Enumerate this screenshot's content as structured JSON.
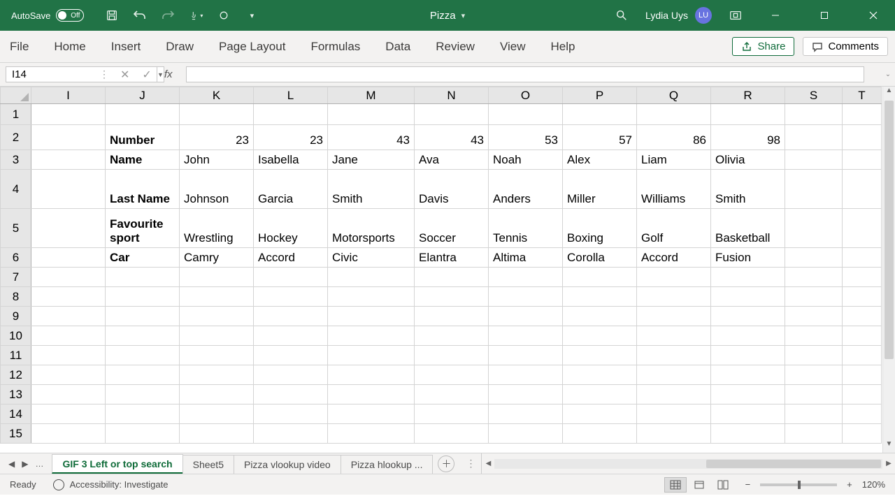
{
  "titlebar": {
    "autosave_label": "AutoSave",
    "autosave_state": "Off",
    "doc_name": "Pizza",
    "user_name": "Lydia Uys",
    "user_initials": "LU"
  },
  "ribbon": {
    "tabs": [
      "File",
      "Home",
      "Insert",
      "Draw",
      "Page Layout",
      "Formulas",
      "Data",
      "Review",
      "View",
      "Help"
    ],
    "share_label": "Share",
    "comments_label": "Comments"
  },
  "formula_bar": {
    "name_box": "I14",
    "formula": ""
  },
  "column_headers": [
    "I",
    "J",
    "K",
    "L",
    "M",
    "N",
    "O",
    "P",
    "Q",
    "R",
    "S",
    "T"
  ],
  "row_numbers": [
    1,
    2,
    3,
    4,
    5,
    6,
    7,
    8,
    9,
    10,
    11,
    12,
    13,
    14,
    15
  ],
  "row_labels": {
    "2": "Number",
    "3": "Name",
    "4": "Last Name",
    "5": "Favourite sport",
    "6": "Car"
  },
  "chart_data": {
    "type": "table",
    "columns": [
      "K",
      "L",
      "M",
      "N",
      "O",
      "P",
      "Q",
      "R"
    ],
    "rows": {
      "Number": [
        23,
        23,
        43,
        43,
        53,
        57,
        86,
        98
      ],
      "Name": [
        "John",
        "Isabella",
        "Jane",
        "Ava",
        "Noah",
        "Alex",
        "Liam",
        "Olivia"
      ],
      "Last Name": [
        "Johnson",
        "Garcia",
        "Smith",
        "Davis",
        "Anders",
        "Miller",
        "Williams",
        "Smith"
      ],
      "Favourite sport": [
        "Wrestling",
        "Hockey",
        "Motorsports",
        "Soccer",
        "Tennis",
        "Boxing",
        "Golf",
        "Basketball"
      ],
      "Car": [
        "Camry",
        "Accord",
        "Civic",
        "Elantra",
        "Altima",
        "Corolla",
        "Accord",
        "Fusion"
      ]
    }
  },
  "sheet_tabs": {
    "active": "GIF 3 Left or top search",
    "others": [
      "Sheet5",
      "Pizza vlookup video",
      "Pizza hlookup ..."
    ]
  },
  "statusbar": {
    "ready": "Ready",
    "accessibility": "Accessibility: Investigate",
    "zoom": "120%"
  }
}
